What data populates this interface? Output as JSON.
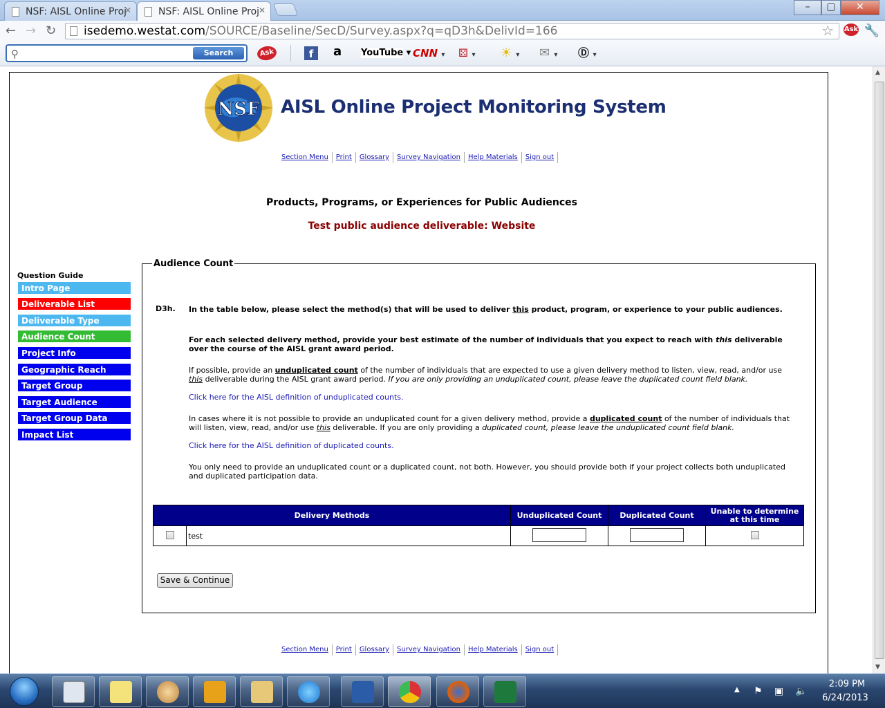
{
  "browser": {
    "tabs": [
      {
        "title": "NSF: AISL Online Proj"
      },
      {
        "title": "NSF: AISL Online Proj"
      }
    ],
    "url_host": "isedemo.westat.com",
    "url_path": "/SOURCE/Baseline/SecD/Survey.aspx?q=qD3h&DelivId=166",
    "window_buttons": {
      "minimize": "–",
      "maximize": "▢",
      "close": "✕"
    }
  },
  "askbar": {
    "search_placeholder": "",
    "search_label": "Search",
    "icons": [
      "ask-icon",
      "facebook-icon",
      "amazon-icon",
      "youtube-icon",
      "cnn-icon",
      "games-icon",
      "weather-icon",
      "mail-icon",
      "dictionary-icon"
    ],
    "youtube_label": "YouTube",
    "cnn_label": "CNN",
    "amazon_label": "a",
    "ask_label": "Ask"
  },
  "site": {
    "logo_text": "NSF",
    "title": "AISL Online Project Monitoring System",
    "nav": [
      "Section Menu",
      "Print",
      "Glossary",
      "Survey Navigation",
      "Help Materials",
      "Sign out"
    ]
  },
  "page": {
    "heading": "Products, Programs, or Experiences for Public Audiences",
    "deliverable": "Test public audience deliverable: Website"
  },
  "question_guide": {
    "title": "Question Guide",
    "items": [
      {
        "label": "Intro Page",
        "color": "#4db8f0"
      },
      {
        "label": "Deliverable List",
        "color": "#ff0000"
      },
      {
        "label": "Deliverable Type",
        "color": "#4db8f0"
      },
      {
        "label": "Audience Count",
        "color": "#33bb33"
      },
      {
        "label": "Project Info",
        "color": "#0000ee"
      },
      {
        "label": "Geographic Reach",
        "color": "#0000ee"
      },
      {
        "label": "Target Group",
        "color": "#0000ee"
      },
      {
        "label": "Target Audience",
        "color": "#0000ee"
      },
      {
        "label": "Target Group Data",
        "color": "#0000ee"
      },
      {
        "label": "Impact List",
        "color": "#0000ee"
      }
    ]
  },
  "form": {
    "legend": "Audience Count",
    "question_number": "D3h.",
    "p1_a": "In the table below, please select the method(s) that will be used to deliver ",
    "p1_u": "this",
    "p1_b": " product, program, or experience to your public audiences.",
    "p2_a": "For each selected delivery method, provide your best estimate of the number of individuals that you expect to reach with ",
    "p2_i": "this",
    "p2_b": " deliverable over the course of the AISL grant award period.",
    "p3_a": "If possible, provide an ",
    "p3_u": "unduplicated count",
    "p3_b": " of the number of individuals that are expected to use a given delivery method to listen, view, read, and/or use ",
    "p3_i": "this",
    "p3_c": " deliverable during the AISL grant award period. ",
    "p3_d": "If you are only providing an unduplicated count, please leave the duplicated count field blank.",
    "link_unduplicated": "Click here for the AISL definition of unduplicated counts.",
    "p4_a": "In cases where it is not possible to provide an unduplicated count for a given delivery method, provide a ",
    "p4_u": "duplicated count",
    "p4_b": " of the number of individuals that will listen, view, read, and/or use ",
    "p4_i": "this",
    "p4_c": " deliverable. If you are only providing a ",
    "p4_d": "duplicated count, please leave the unduplicated count field blank.",
    "link_duplicated": "Click here for the AISL definition of duplicated counts.",
    "p5": "You only need to provide an unduplicated count or a duplicated count, not both. However, you should provide both if your project collects both unduplicated and duplicated participation data.",
    "table": {
      "headers": [
        "Delivery Methods",
        "Unduplicated Count",
        "Duplicated Count",
        "Unable to determine at this time"
      ],
      "rows": [
        {
          "method": "test",
          "unduplicated": "",
          "duplicated": "",
          "unable": false,
          "selected": false
        }
      ]
    },
    "save_label": "Save & Continue"
  },
  "taskbar": {
    "apps": [
      "task-manager",
      "sticky-notes",
      "paint",
      "outlook",
      "explorer",
      "internet-explorer",
      "word",
      "chrome",
      "firefox",
      "excel"
    ],
    "time": "2:09 PM",
    "date": "6/24/2013"
  }
}
